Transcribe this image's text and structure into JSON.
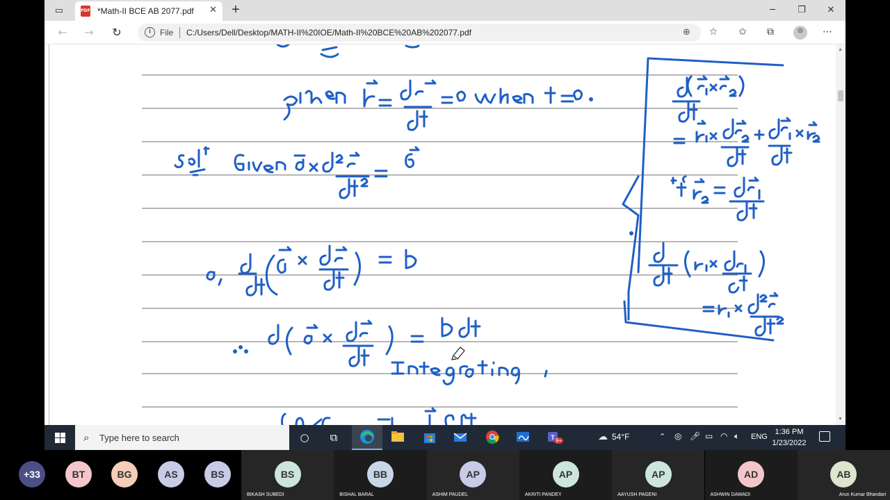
{
  "browser": {
    "tab_title": "*Math-II BCE AB 2077.pdf",
    "tab_icon": "PDF",
    "address_scheme_label": "File",
    "url": "C:/Users/Dell/Desktop/MATH-II%20IOE/Math-II%20BCE%20AB%202077.pdf"
  },
  "taskbar": {
    "search_placeholder": "Type here to search",
    "teams_badge": "9+",
    "weather": "54°F",
    "language": "ENG",
    "time": "1:36 PM",
    "date": "1/23/2022"
  },
  "meeting": {
    "overflow_count": "+33",
    "small_avatars": [
      {
        "initials": "BT",
        "color": "#f4c6cc"
      },
      {
        "initials": "BG",
        "color": "#f6cdb8"
      },
      {
        "initials": "AS",
        "color": "#c8cbe8"
      },
      {
        "initials": "BS",
        "color": "#c8cbe8"
      }
    ],
    "participants": [
      {
        "initials": "BS",
        "name": "BIKASH SUBEDI",
        "color": "#cde6dc"
      },
      {
        "initials": "BB",
        "name": "BISHAL BARAL",
        "color": "#c8d6e8"
      },
      {
        "initials": "AP",
        "name": "ASHIM PAUDEL",
        "color": "#c8cbe8"
      },
      {
        "initials": "AP",
        "name": "AKRITI PANDEY",
        "color": "#cde6dc"
      },
      {
        "initials": "AP",
        "name": "AAYUSH PAGENI",
        "color": "#cde6dc"
      },
      {
        "initials": "AD",
        "name": "ASHWIN DAWADI",
        "color": "#f4c6cc"
      },
      {
        "initials": "AB",
        "name": "Arun Kumar Bhandari",
        "color": "#dde6cd"
      }
    ]
  },
  "colors": {
    "ink": "#1f5fc4",
    "rule_lines": "#8a8a8a",
    "taskbar": "#202a36",
    "strip": "#000000"
  }
}
